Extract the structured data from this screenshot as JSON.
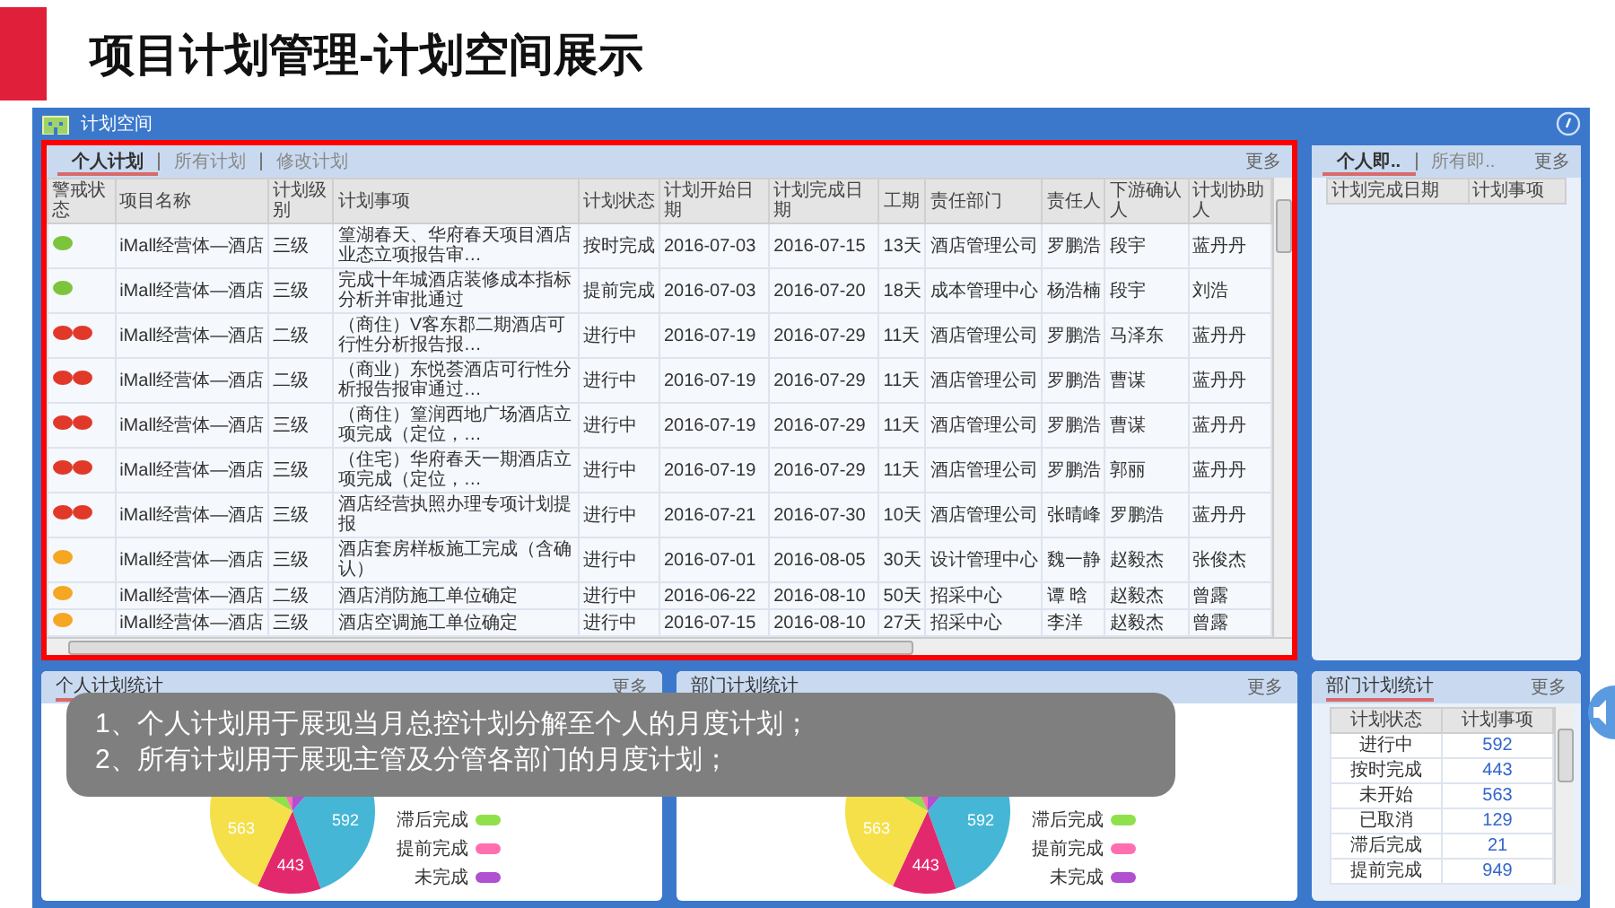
{
  "slide": {
    "title": "项目计划管理-计划空间展示"
  },
  "window": {
    "title": "计划空间"
  },
  "plan_panel": {
    "tabs": [
      {
        "label": "个人计划",
        "selected": true
      },
      {
        "label": "所有计划",
        "selected": false
      },
      {
        "label": "修改计划",
        "selected": false
      }
    ],
    "more": "更多",
    "table": {
      "columns": [
        "警戒状态",
        "项目名称",
        "计划级别",
        "计划事项",
        "计划状态",
        "计划开始日期",
        "计划完成日期",
        "工期",
        "责任部门",
        "责任人",
        "下游确认人",
        "计划协助人"
      ],
      "rows": [
        {
          "kind": "single",
          "color": "#7cc43c",
          "cells": [
            "",
            "iMall经营体—酒店",
            "三级",
            "篁湖春天、华府春天项目酒店业态立项报告审…",
            "按时完成",
            "2016-07-03",
            "2016-07-15",
            "13天",
            "酒店管理公司",
            "罗鹏浩",
            "段宇",
            "蓝丹丹"
          ]
        },
        {
          "kind": "single",
          "color": "#7cc43c",
          "cells": [
            "",
            "iMall经营体—酒店",
            "三级",
            "完成十年城酒店装修成本指标分析并审批通过",
            "提前完成",
            "2016-07-03",
            "2016-07-20",
            "18天",
            "成本管理中心",
            "杨浩楠",
            "段宇",
            "刘浩"
          ]
        },
        {
          "kind": "double",
          "color": "#e0392a",
          "cells": [
            "",
            "iMall经营体—酒店",
            "二级",
            "（商住）V客东郡二期酒店可行性分析报告报…",
            "进行中",
            "2016-07-19",
            "2016-07-29",
            "11天",
            "酒店管理公司",
            "罗鹏浩",
            "马泽东",
            "蓝丹丹"
          ]
        },
        {
          "kind": "double",
          "color": "#e0392a",
          "cells": [
            "",
            "iMall经营体—酒店",
            "二级",
            "（商业）东悦荟酒店可行性分析报告报审通过…",
            "进行中",
            "2016-07-19",
            "2016-07-29",
            "11天",
            "酒店管理公司",
            "罗鹏浩",
            "曹谋",
            "蓝丹丹"
          ]
        },
        {
          "kind": "double",
          "color": "#e0392a",
          "cells": [
            "",
            "iMall经营体—酒店",
            "三级",
            "（商住）篁润西地广场酒店立项完成（定位，…",
            "进行中",
            "2016-07-19",
            "2016-07-29",
            "11天",
            "酒店管理公司",
            "罗鹏浩",
            "曹谋",
            "蓝丹丹"
          ]
        },
        {
          "kind": "double",
          "color": "#e0392a",
          "cells": [
            "",
            "iMall经营体—酒店",
            "三级",
            "（住宅）华府春天一期酒店立项完成（定位，…",
            "进行中",
            "2016-07-19",
            "2016-07-29",
            "11天",
            "酒店管理公司",
            "罗鹏浩",
            "郭丽",
            "蓝丹丹"
          ]
        },
        {
          "kind": "double",
          "color": "#e0392a",
          "cells": [
            "",
            "iMall经营体—酒店",
            "三级",
            "酒店经营执照办理专项计划提报",
            "进行中",
            "2016-07-21",
            "2016-07-30",
            "10天",
            "酒店管理公司",
            "张晴峰",
            "罗鹏浩",
            "蓝丹丹"
          ]
        },
        {
          "kind": "single",
          "color": "#f5a623",
          "cells": [
            "",
            "iMall经营体—酒店",
            "三级",
            "酒店套房样板施工完成（含确认）",
            "进行中",
            "2016-07-01",
            "2016-08-05",
            "30天",
            "设计管理中心",
            "魏一静",
            "赵毅杰",
            "张俊杰"
          ]
        },
        {
          "kind": "single",
          "color": "#f5a623",
          "cells": [
            "",
            "iMall经营体—酒店",
            "二级",
            "酒店消防施工单位确定",
            "进行中",
            "2016-06-22",
            "2016-08-10",
            "50天",
            "招采中心",
            "谭 晗",
            "赵毅杰",
            "曾露"
          ]
        },
        {
          "kind": "single",
          "color": "#f5a623",
          "cells": [
            "",
            "iMall经营体—酒店",
            "三级",
            "酒店空调施工单位确定",
            "进行中",
            "2016-07-15",
            "2016-08-10",
            "27天",
            "招采中心",
            "李洋",
            "赵毅杰",
            "曾露"
          ]
        }
      ]
    }
  },
  "upcoming_panel": {
    "tabs": [
      {
        "label": "个人即..",
        "selected": true
      },
      {
        "label": "所有即..",
        "selected": false
      }
    ],
    "more": "更多",
    "columns": [
      "计划完成日期",
      "计划事项"
    ]
  },
  "stat_panels": [
    {
      "title": "个人计划统计",
      "more": "更多",
      "pie_labels": [
        "563",
        "443",
        "592"
      ],
      "legend": [
        {
          "label": "滞后完成",
          "color": "#8fe04a"
        },
        {
          "label": "提前完成",
          "color": "#ff6fb0"
        },
        {
          "label": "未完成",
          "color": "#b04fd0"
        }
      ]
    },
    {
      "title": "部门计划统计",
      "more": "更多",
      "pie_labels": [
        "563",
        "443",
        "592"
      ],
      "legend": [
        {
          "label": "滞后完成",
          "color": "#8fe04a"
        },
        {
          "label": "提前完成",
          "color": "#ff6fb0"
        },
        {
          "label": "未完成",
          "color": "#b04fd0"
        }
      ]
    }
  ],
  "dept_table_panel": {
    "title": "部门计划统计",
    "more": "更多",
    "columns": [
      "计划状态",
      "计划事项"
    ],
    "rows": [
      [
        "进行中",
        "592"
      ],
      [
        "按时完成",
        "443"
      ],
      [
        "未开始",
        "563"
      ],
      [
        "已取消",
        "129"
      ],
      [
        "滞后完成",
        "21"
      ],
      [
        "提前完成",
        "949"
      ]
    ]
  },
  "note": {
    "lines": [
      "1、个人计划用于展现当月总控计划分解至个人的月度计划；",
      "2、所有计划用于展现主管及分管各部门的月度计划；"
    ]
  }
}
